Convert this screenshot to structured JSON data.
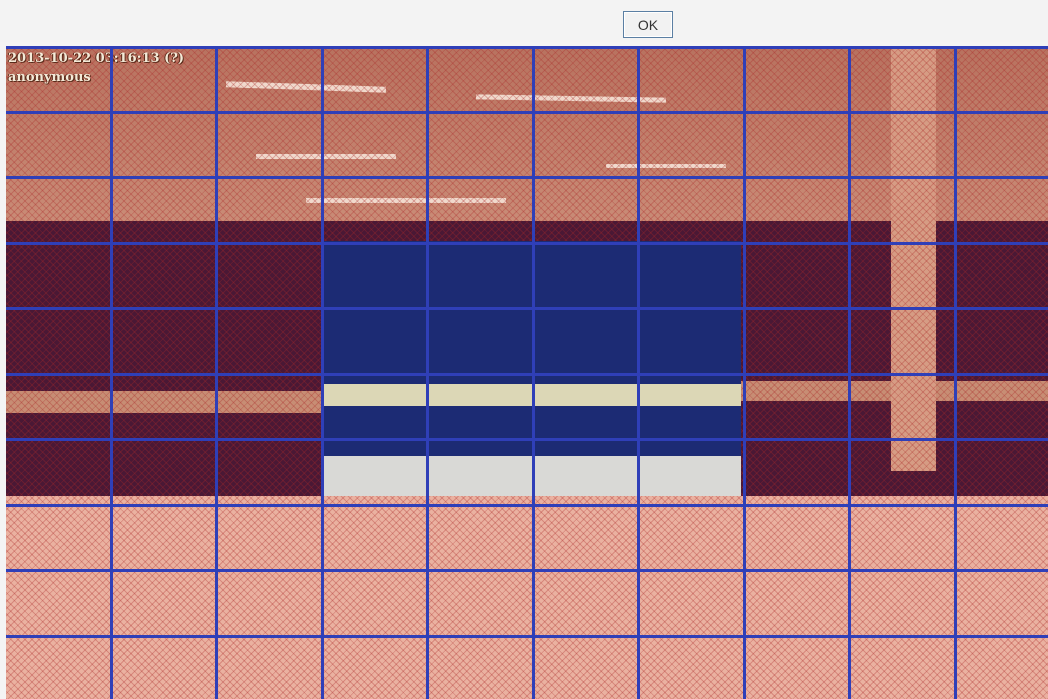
{
  "dialog": {
    "ok_label": "OK"
  },
  "video": {
    "timestamp": "2013-10-22 03:16:13 (?)",
    "user": "anonymous"
  },
  "motion_grid": {
    "rows": 10,
    "cols": 10,
    "unselected_cells": [
      [
        3,
        3
      ],
      [
        3,
        4
      ],
      [
        3,
        5
      ],
      [
        4,
        3
      ],
      [
        4,
        4
      ],
      [
        4,
        5
      ],
      [
        5,
        3
      ],
      [
        5,
        4
      ],
      [
        5,
        5
      ],
      [
        6,
        3
      ],
      [
        6,
        4
      ],
      [
        6,
        5
      ]
    ]
  },
  "colors": {
    "grid_line": "#2f3fb8",
    "selected_overlay": "#e8a898"
  }
}
